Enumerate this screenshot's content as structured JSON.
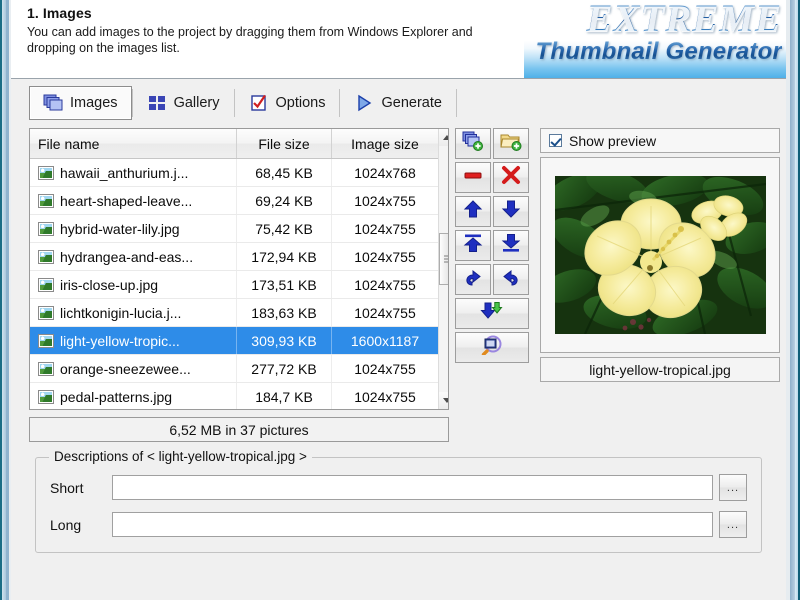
{
  "header": {
    "title": "1. Images",
    "description": "You can add images to the project by dragging them from Windows Explorer and dropping on the images list.",
    "logo_main": "EXTREME",
    "logo_sub": "Thumbnail Generator"
  },
  "tabs": [
    {
      "label": "Images",
      "icon": "stacked-images-icon",
      "selected": true
    },
    {
      "label": "Gallery",
      "icon": "grid-icon",
      "selected": false
    },
    {
      "label": "Options",
      "icon": "checklist-icon",
      "selected": false
    },
    {
      "label": "Generate",
      "icon": "play-triangle-icon",
      "selected": false
    }
  ],
  "filelist": {
    "columns": [
      "File name",
      "File size",
      "Image size"
    ],
    "rows": [
      {
        "name": "hawaii_anthurium.j...",
        "size": "68,45 KB",
        "dimensions": "1024x768",
        "selected": false
      },
      {
        "name": "heart-shaped-leave...",
        "size": "69,24 KB",
        "dimensions": "1024x755",
        "selected": false
      },
      {
        "name": "hybrid-water-lily.jpg",
        "size": "75,42 KB",
        "dimensions": "1024x755",
        "selected": false
      },
      {
        "name": "hydrangea-and-eas...",
        "size": "172,94 KB",
        "dimensions": "1024x755",
        "selected": false
      },
      {
        "name": "iris-close-up.jpg",
        "size": "173,51 KB",
        "dimensions": "1024x755",
        "selected": false
      },
      {
        "name": "lichtkonigin-lucia.j...",
        "size": "183,63 KB",
        "dimensions": "1024x755",
        "selected": false
      },
      {
        "name": "light-yellow-tropic...",
        "size": "309,93 KB",
        "dimensions": "1600x1187",
        "selected": true
      },
      {
        "name": "orange-sneezewee...",
        "size": "277,72 KB",
        "dimensions": "1024x755",
        "selected": false
      },
      {
        "name": "pedal-patterns.jpg",
        "size": "184,7 KB",
        "dimensions": "1024x755",
        "selected": false
      }
    ],
    "total": "6,52 MB in 37 pictures",
    "selection_color": "#2e8ce8"
  },
  "toolbar": [
    {
      "name": "add-images-button",
      "icon": "stacked-images-plus-icon"
    },
    {
      "name": "add-folder-button",
      "icon": "folder-plus-icon"
    },
    {
      "name": "remove-button",
      "icon": "minus-icon"
    },
    {
      "name": "clear-all-button",
      "icon": "red-x-icon"
    },
    {
      "name": "move-up-button",
      "icon": "arrow-up-icon"
    },
    {
      "name": "move-down-button",
      "icon": "arrow-down-icon"
    },
    {
      "name": "move-to-top-button",
      "icon": "arrow-to-top-icon"
    },
    {
      "name": "move-to-bottom-button",
      "icon": "arrow-to-bottom-icon"
    },
    {
      "name": "undo-button",
      "icon": "undo-arrow-icon"
    },
    {
      "name": "redo-button",
      "icon": "redo-arrow-icon"
    },
    {
      "name": "sort-button",
      "icon": "sort-down-icon"
    },
    {
      "name": "preview-button",
      "icon": "magnifier-image-icon"
    }
  ],
  "preview": {
    "show_preview_label": "Show preview",
    "show_preview_checked": true,
    "image_alt": "yellow-hibiscus-flower",
    "filename": "light-yellow-tropical.jpg"
  },
  "descriptions": {
    "legend": "Descriptions of < light-yellow-tropical.jpg >",
    "short_label": "Short",
    "short_value": "",
    "short_placeholder": "",
    "long_label": "Long",
    "long_value": "",
    "long_placeholder": "",
    "browse_label": "..."
  }
}
